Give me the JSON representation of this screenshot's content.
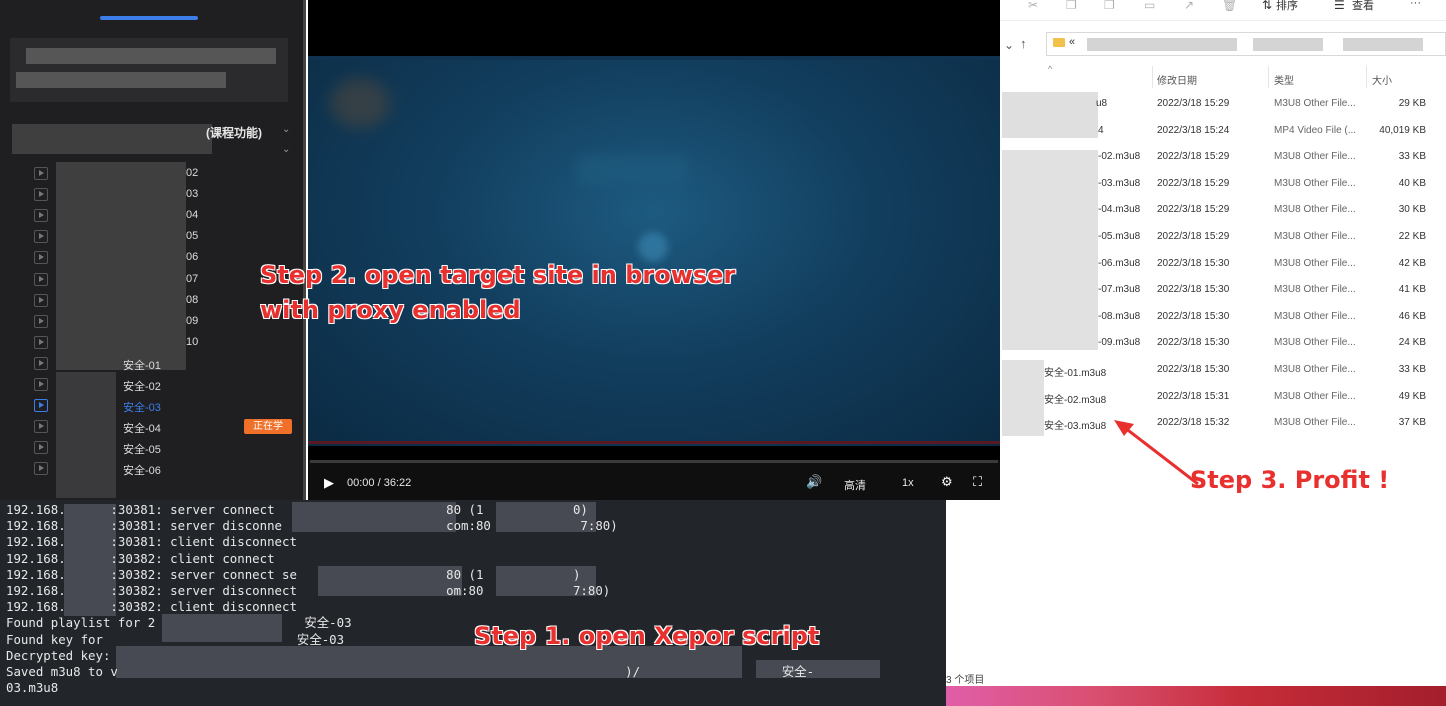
{
  "sidebar": {
    "section_title": "(课程功能)",
    "lessons": [
      {
        "label": "02"
      },
      {
        "label": "03"
      },
      {
        "label": "04"
      },
      {
        "label": "05"
      },
      {
        "label": "06"
      },
      {
        "label": "07"
      },
      {
        "label": "08"
      },
      {
        "label": "09"
      },
      {
        "label": "10"
      },
      {
        "label": "安全-01"
      },
      {
        "label": "安全-02"
      },
      {
        "label": "安全-03"
      },
      {
        "label": "安全-04"
      },
      {
        "label": "安全-05"
      },
      {
        "label": "安全-06"
      }
    ],
    "active_badge": "正在学"
  },
  "player": {
    "time": "00:00 / 36:22",
    "quality": "高清",
    "speed": "1x"
  },
  "explorer": {
    "toolbar": {
      "sort": "排序",
      "view": "查看",
      "more": "···"
    },
    "address_prefix": "«",
    "columns": {
      "date": "修改日期",
      "type": "类型",
      "size": "大小"
    },
    "files": [
      {
        "name": "u8",
        "date": "2022/3/18 15:29",
        "type": "M3U8 Other File...",
        "size": "29 KB"
      },
      {
        "name": "4",
        "date": "2022/3/18 15:24",
        "type": "MP4 Video File (...",
        "size": "40,019 KB"
      },
      {
        "name": "-02.m3u8",
        "date": "2022/3/18 15:29",
        "type": "M3U8 Other File...",
        "size": "33 KB"
      },
      {
        "name": "-03.m3u8",
        "date": "2022/3/18 15:29",
        "type": "M3U8 Other File...",
        "size": "40 KB"
      },
      {
        "name": "-04.m3u8",
        "date": "2022/3/18 15:29",
        "type": "M3U8 Other File...",
        "size": "30 KB"
      },
      {
        "name": "-05.m3u8",
        "date": "2022/3/18 15:29",
        "type": "M3U8 Other File...",
        "size": "22 KB"
      },
      {
        "name": "-06.m3u8",
        "date": "2022/3/18 15:30",
        "type": "M3U8 Other File...",
        "size": "42 KB"
      },
      {
        "name": "-07.m3u8",
        "date": "2022/3/18 15:30",
        "type": "M3U8 Other File...",
        "size": "41 KB"
      },
      {
        "name": "-08.m3u8",
        "date": "2022/3/18 15:30",
        "type": "M3U8 Other File...",
        "size": "46 KB"
      },
      {
        "name": "-09.m3u8",
        "date": "2022/3/18 15:30",
        "type": "M3U8 Other File...",
        "size": "24 KB"
      },
      {
        "name": "安全-01.m3u8",
        "date": "2022/3/18 15:30",
        "type": "M3U8 Other File...",
        "size": "33 KB"
      },
      {
        "name": "安全-02.m3u8",
        "date": "2022/3/18 15:31",
        "type": "M3U8 Other File...",
        "size": "49 KB"
      },
      {
        "name": "安全-03.m3u8",
        "date": "2022/3/18 15:32",
        "type": "M3U8 Other File...",
        "size": "37 KB"
      }
    ],
    "status": "3 个项目"
  },
  "terminal": {
    "lines": [
      "192.168.      :30381: server connect                       80 (1            0)",
      "192.168.      :30381: server disconne                      com:80            7:80)",
      "192.168.      :30381: client disconnect",
      "192.168.      :30382: client connect",
      "192.168.      :30382: server connect se                    80 (1            )",
      "192.168.      :30382: server disconnect                    om:80            7:80)",
      "192.168.      :30382: client disconnect",
      "Found playlist for 2                    安全-03",
      "Found key for                          安全-03",
      "Decrypted key:",
      "Saved m3u8 to v                                                                    )/                   安全-",
      "03.m3u8"
    ]
  },
  "annotations": {
    "step1": "Step 1. open Xepor script",
    "step2_line1": "Step 2. open target site in browser",
    "step2_line2": "with proxy enabled",
    "step3": "Step 3. Profit !"
  },
  "colors": {
    "annotation": "#e8312f",
    "accent": "#3b7de9",
    "badge": "#f0702a"
  }
}
